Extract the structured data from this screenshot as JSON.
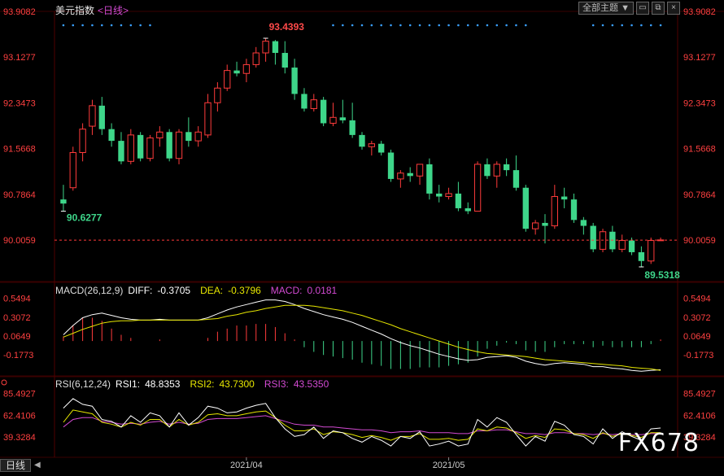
{
  "header": {
    "title": "美元指数",
    "period": "<日线>",
    "theme_dropdown": "全部主题"
  },
  "watermark": "FX678",
  "bottom_tab": "日线",
  "colors": {
    "up": "#ff3b3b",
    "down": "#3ed68a",
    "diff": "#ffffff",
    "dea": "#e6e600",
    "macd": "#d24ad2",
    "rsi1": "#ffffff",
    "rsi2": "#e6e600",
    "rsi3": "#d24ad2",
    "axis": "#ff4040",
    "dots": "#3aa0ff"
  },
  "chart_data": [
    {
      "type": "candlestick",
      "title": "美元指数",
      "period": "日线",
      "price_ticks": [
        "93.9082",
        "93.1277",
        "92.3473",
        "91.5668",
        "90.7864",
        "90.0059"
      ],
      "ylim": [
        89.3,
        93.9082
      ],
      "current_price": 90.0059,
      "high_label": "93.4393",
      "low_label_left": "90.6277",
      "low_label_right": "89.5318",
      "x_labels": [
        "2021/04",
        "2021/05"
      ],
      "x_label_index": [
        19,
        40
      ],
      "candles": [
        [
          90.7,
          90.95,
          90.5,
          90.63
        ],
        [
          90.9,
          91.6,
          90.85,
          91.5
        ],
        [
          91.5,
          92.0,
          91.35,
          91.9
        ],
        [
          91.95,
          92.4,
          91.8,
          92.3
        ],
        [
          92.3,
          92.45,
          91.8,
          91.9
        ],
        [
          91.9,
          92.0,
          91.6,
          91.7
        ],
        [
          91.7,
          91.85,
          91.3,
          91.35
        ],
        [
          91.35,
          91.9,
          91.3,
          91.8
        ],
        [
          91.8,
          91.85,
          91.35,
          91.4
        ],
        [
          91.4,
          91.8,
          91.35,
          91.75
        ],
        [
          91.75,
          91.95,
          91.6,
          91.85
        ],
        [
          91.85,
          91.9,
          91.35,
          91.4
        ],
        [
          91.4,
          91.9,
          91.3,
          91.85
        ],
        [
          91.85,
          92.1,
          91.6,
          91.7
        ],
        [
          91.7,
          91.95,
          91.6,
          91.85
        ],
        [
          91.8,
          92.5,
          91.75,
          92.35
        ],
        [
          92.35,
          92.7,
          92.2,
          92.6
        ],
        [
          92.6,
          93.0,
          92.55,
          92.9
        ],
        [
          92.9,
          93.05,
          92.8,
          92.85
        ],
        [
          92.85,
          93.1,
          92.7,
          93.0
        ],
        [
          93.0,
          93.3,
          92.95,
          93.2
        ],
        [
          93.2,
          93.45,
          93.05,
          93.4
        ],
        [
          93.4,
          93.42,
          93.0,
          93.2
        ],
        [
          93.2,
          93.4,
          92.85,
          92.95
        ],
        [
          92.95,
          93.1,
          92.4,
          92.5
        ],
        [
          92.5,
          92.6,
          92.2,
          92.25
        ],
        [
          92.25,
          92.5,
          92.2,
          92.4
        ],
        [
          92.4,
          92.45,
          91.95,
          92.0
        ],
        [
          92.0,
          92.35,
          91.95,
          92.1
        ],
        [
          92.1,
          92.4,
          92.0,
          92.05
        ],
        [
          92.05,
          92.35,
          91.75,
          91.8
        ],
        [
          91.8,
          91.85,
          91.55,
          91.6
        ],
        [
          91.6,
          91.7,
          91.45,
          91.65
        ],
        [
          91.65,
          91.7,
          91.45,
          91.5
        ],
        [
          91.5,
          91.55,
          91.0,
          91.05
        ],
        [
          91.05,
          91.2,
          90.9,
          91.15
        ],
        [
          91.15,
          91.25,
          91.0,
          91.1
        ],
        [
          91.1,
          91.3,
          90.95,
          91.3
        ],
        [
          91.3,
          91.4,
          90.7,
          90.8
        ],
        [
          90.8,
          90.95,
          90.65,
          90.75
        ],
        [
          90.75,
          90.9,
          90.7,
          90.8
        ],
        [
          90.8,
          91.0,
          90.5,
          90.55
        ],
        [
          90.55,
          90.65,
          90.45,
          90.5
        ],
        [
          90.5,
          91.35,
          90.5,
          91.3
        ],
        [
          91.3,
          91.4,
          91.05,
          91.1
        ],
        [
          91.1,
          91.35,
          90.9,
          91.3
        ],
        [
          91.3,
          91.4,
          91.1,
          91.2
        ],
        [
          91.2,
          91.45,
          90.85,
          90.9
        ],
        [
          90.9,
          90.95,
          90.15,
          90.2
        ],
        [
          90.2,
          90.35,
          90.1,
          90.3
        ],
        [
          90.3,
          90.45,
          89.95,
          90.25
        ],
        [
          90.25,
          90.95,
          90.2,
          90.75
        ],
        [
          90.75,
          90.9,
          90.55,
          90.7
        ],
        [
          90.7,
          90.8,
          90.3,
          90.35
        ],
        [
          90.35,
          90.4,
          90.1,
          90.25
        ],
        [
          90.25,
          90.3,
          89.8,
          89.85
        ],
        [
          89.85,
          90.2,
          89.8,
          90.15
        ],
        [
          90.15,
          90.25,
          89.8,
          89.85
        ],
        [
          89.85,
          90.1,
          89.8,
          90.0
        ],
        [
          90.0,
          90.05,
          89.75,
          89.8
        ],
        [
          89.8,
          89.9,
          89.55,
          89.65
        ],
        [
          89.65,
          90.05,
          89.6,
          90.0
        ],
        [
          90.0,
          90.05,
          90.0,
          90.01
        ]
      ]
    },
    {
      "type": "line",
      "title": "MACD",
      "legend": {
        "name": "MACD(26,12,9)",
        "diff_label": "DIFF:",
        "diff": "-0.3705",
        "dea_label": "DEA:",
        "dea": "-0.3796",
        "macd_label": "MACD:",
        "macd": "0.0181"
      },
      "ticks": [
        "0.5494",
        "0.3072",
        "0.0649",
        "-0.1773"
      ],
      "ylim": [
        -0.45,
        0.62
      ],
      "diff": [
        0.08,
        0.2,
        0.3,
        0.34,
        0.36,
        0.33,
        0.3,
        0.28,
        0.27,
        0.27,
        0.28,
        0.27,
        0.27,
        0.27,
        0.27,
        0.3,
        0.35,
        0.4,
        0.44,
        0.47,
        0.5,
        0.53,
        0.53,
        0.51,
        0.47,
        0.42,
        0.38,
        0.34,
        0.31,
        0.28,
        0.24,
        0.19,
        0.14,
        0.09,
        0.03,
        -0.02,
        -0.06,
        -0.09,
        -0.13,
        -0.17,
        -0.2,
        -0.23,
        -0.25,
        -0.24,
        -0.21,
        -0.2,
        -0.19,
        -0.21,
        -0.26,
        -0.29,
        -0.31,
        -0.29,
        -0.28,
        -0.29,
        -0.3,
        -0.33,
        -0.33,
        -0.35,
        -0.36,
        -0.38,
        -0.39,
        -0.38,
        -0.37
      ],
      "dea": [
        0.05,
        0.1,
        0.15,
        0.19,
        0.23,
        0.25,
        0.26,
        0.26,
        0.27,
        0.27,
        0.27,
        0.27,
        0.27,
        0.27,
        0.27,
        0.28,
        0.29,
        0.32,
        0.34,
        0.37,
        0.39,
        0.42,
        0.44,
        0.46,
        0.46,
        0.46,
        0.45,
        0.43,
        0.41,
        0.39,
        0.36,
        0.33,
        0.29,
        0.25,
        0.21,
        0.16,
        0.12,
        0.08,
        0.04,
        0.0,
        -0.04,
        -0.08,
        -0.11,
        -0.14,
        -0.16,
        -0.17,
        -0.18,
        -0.19,
        -0.2,
        -0.22,
        -0.24,
        -0.25,
        -0.26,
        -0.27,
        -0.28,
        -0.29,
        -0.3,
        -0.31,
        -0.32,
        -0.34,
        -0.35,
        -0.36,
        -0.38
      ]
    },
    {
      "type": "line",
      "title": "RSI",
      "legend": {
        "name": "RSI(6,12,24)",
        "rsi1_label": "RSI1:",
        "rsi1": "48.8353",
        "rsi2_label": "RSI2:",
        "rsi2": "43.7300",
        "rsi3_label": "RSI3:",
        "rsi3": "43.5350"
      },
      "ticks": [
        "85.4927",
        "62.4106",
        "39.3284"
      ],
      "ylim": [
        18,
        92
      ],
      "rsi1": [
        70,
        80,
        74,
        72,
        58,
        56,
        50,
        62,
        55,
        65,
        62,
        50,
        65,
        52,
        60,
        72,
        70,
        65,
        66,
        70,
        73,
        75,
        60,
        48,
        40,
        42,
        50,
        38,
        46,
        44,
        38,
        34,
        40,
        36,
        30,
        40,
        38,
        45,
        30,
        32,
        35,
        30,
        32,
        58,
        50,
        60,
        55,
        42,
        30,
        40,
        35,
        56,
        52,
        42,
        40,
        32,
        48,
        38,
        45,
        40,
        36,
        48,
        49
      ],
      "rsi2": [
        55,
        68,
        66,
        64,
        55,
        53,
        50,
        55,
        52,
        58,
        58,
        50,
        58,
        52,
        55,
        63,
        64,
        62,
        62,
        64,
        66,
        67,
        60,
        52,
        46,
        46,
        48,
        42,
        45,
        44,
        42,
        39,
        41,
        39,
        36,
        40,
        40,
        43,
        37,
        37,
        38,
        36,
        37,
        48,
        46,
        50,
        49,
        44,
        38,
        41,
        39,
        48,
        47,
        43,
        42,
        38,
        44,
        40,
        43,
        41,
        39,
        44,
        44
      ],
      "rsi3": [
        50,
        58,
        60,
        60,
        56,
        55,
        53,
        54,
        53,
        55,
        56,
        53,
        55,
        53,
        54,
        58,
        59,
        59,
        59,
        60,
        61,
        62,
        59,
        56,
        53,
        52,
        52,
        50,
        50,
        49,
        48,
        47,
        47,
        46,
        44,
        45,
        45,
        46,
        44,
        44,
        44,
        43,
        43,
        46,
        46,
        47,
        47,
        45,
        43,
        43,
        42,
        44,
        44,
        43,
        43,
        42,
        43,
        42,
        43,
        42,
        42,
        43,
        43
      ]
    }
  ]
}
